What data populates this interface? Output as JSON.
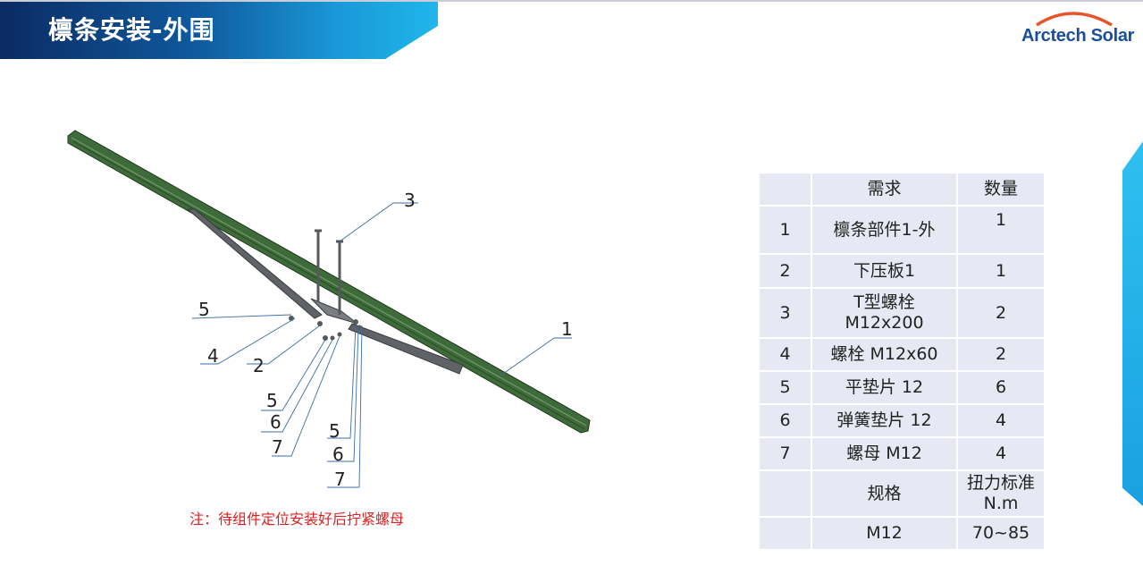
{
  "header": {
    "title": "檩条安装-外围"
  },
  "logo": {
    "text": "Arctech Solar",
    "brand_color": "#1b4f9c",
    "arc_color": "#e8542a"
  },
  "diagram": {
    "callouts": [
      "3",
      "1",
      "5",
      "4",
      "2",
      "5",
      "6",
      "7",
      "5",
      "6",
      "7"
    ]
  },
  "note": "注：待组件定位安装好后拧紧螺母",
  "table": {
    "headers": [
      "",
      "需求",
      "数量"
    ],
    "rows": [
      {
        "num": "1",
        "name": "檩条部件1-外",
        "qty": "1"
      },
      {
        "num": "2",
        "name": "下压板1",
        "qty": "1"
      },
      {
        "num": "3",
        "name": "T型螺栓\nM12x200",
        "qty": "2"
      },
      {
        "num": "4",
        "name": "螺栓 M12x60",
        "qty": "2"
      },
      {
        "num": "5",
        "name": "平垫片 12",
        "qty": "6"
      },
      {
        "num": "6",
        "name": "弹簧垫片 12",
        "qty": "4"
      },
      {
        "num": "7",
        "name": "螺母 M12",
        "qty": "4"
      }
    ],
    "spec_header": {
      "label": "规格",
      "torque": "扭力标准\nN.m"
    },
    "spec_row": {
      "label": "M12",
      "value": "70~85"
    }
  },
  "colors": {
    "beam": "#3f6b3a",
    "bracket": "#5f6266",
    "note": "#e02020",
    "callout_line": "#3b6ea8"
  }
}
